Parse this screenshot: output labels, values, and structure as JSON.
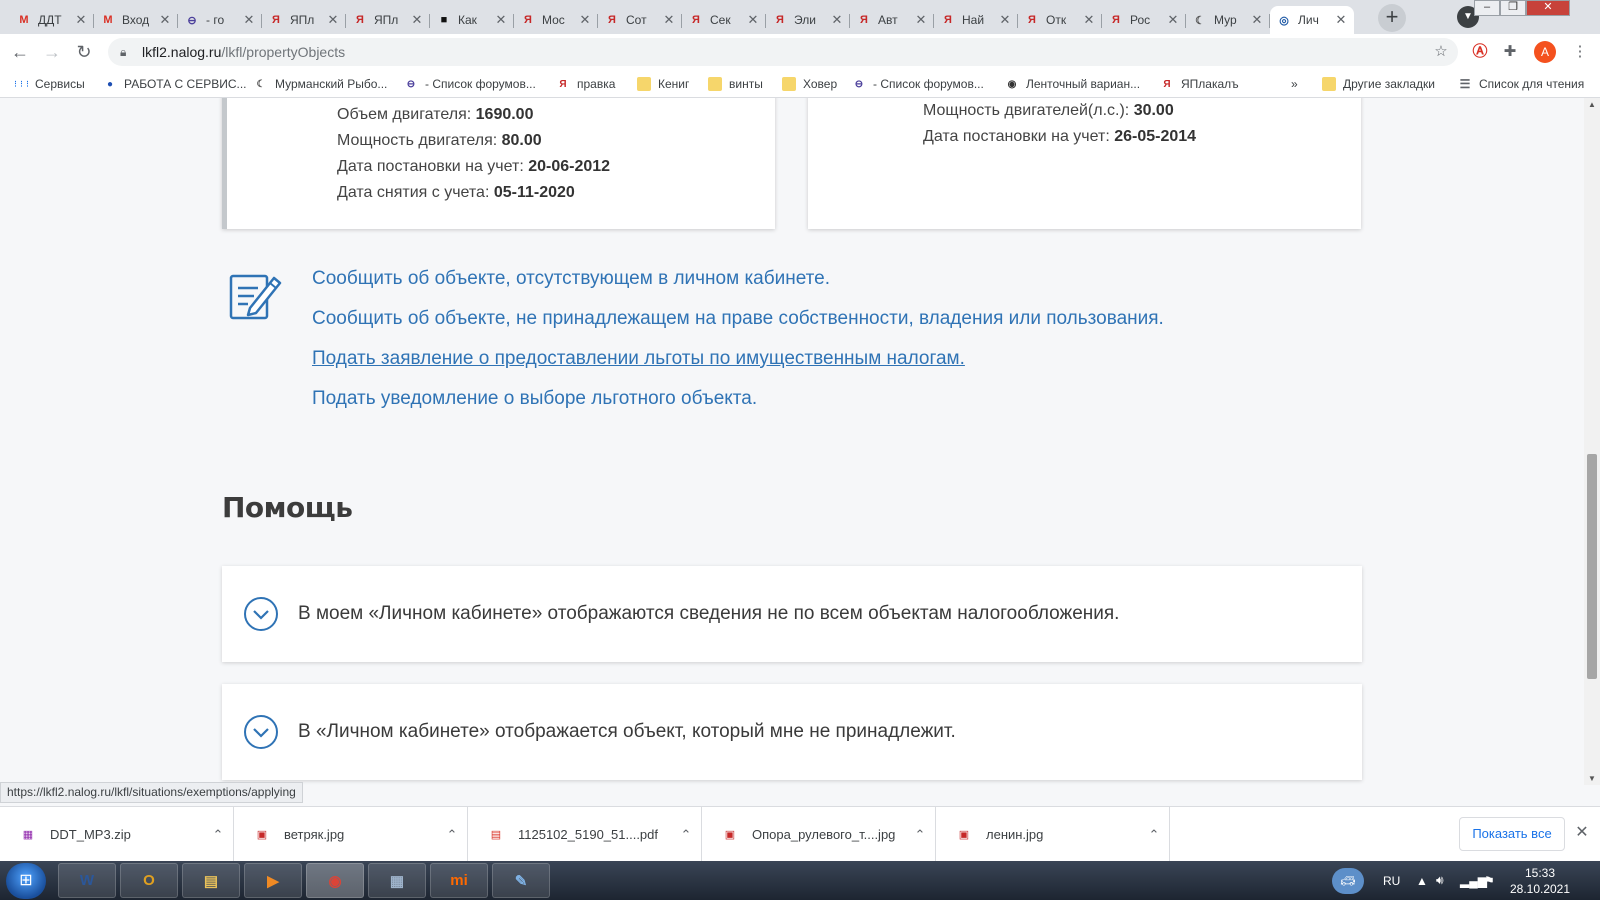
{
  "colors": {
    "link": "#2f73b5",
    "tab_strip": "#dee1e6",
    "avatar": "#f4511e"
  },
  "tabs": [
    {
      "title": "ДДТ",
      "icon": "gmail-icon",
      "glyph": "M",
      "color": "#d93025"
    },
    {
      "title": "Вход",
      "icon": "gmail-icon",
      "glyph": "M",
      "color": "#d93025"
    },
    {
      "title": "- го",
      "icon": "forum-icon",
      "glyph": "⊖",
      "color": "#4b3f9b"
    },
    {
      "title": "ЯПл",
      "icon": "yaplakal-icon",
      "glyph": "Я",
      "color": "#c62828"
    },
    {
      "title": "ЯПл",
      "icon": "yaplakal-icon",
      "glyph": "Я",
      "color": "#c62828"
    },
    {
      "title": "Как",
      "icon": "site-icon",
      "glyph": "■",
      "color": "#111111"
    },
    {
      "title": "Мос",
      "icon": "yaplakal-icon",
      "glyph": "Я",
      "color": "#c62828"
    },
    {
      "title": "Сот",
      "icon": "yaplakal-icon",
      "glyph": "Я",
      "color": "#c62828"
    },
    {
      "title": "Сек",
      "icon": "yaplakal-icon",
      "glyph": "Я",
      "color": "#c62828"
    },
    {
      "title": "Эли",
      "icon": "yaplakal-icon",
      "glyph": "Я",
      "color": "#c62828"
    },
    {
      "title": "Авт",
      "icon": "yaplakal-icon",
      "glyph": "Я",
      "color": "#c62828"
    },
    {
      "title": "Най",
      "icon": "yaplakal-icon",
      "glyph": "Я",
      "color": "#c62828"
    },
    {
      "title": "Отк",
      "icon": "yaplakal-icon",
      "glyph": "Я",
      "color": "#c62828"
    },
    {
      "title": "Рос",
      "icon": "yaplakal-icon",
      "glyph": "Я",
      "color": "#c62828"
    },
    {
      "title": "Мур",
      "icon": "fish-icon",
      "glyph": "☾",
      "color": "#555555"
    },
    {
      "title": "Лич",
      "icon": "nalog-icon",
      "glyph": "◎",
      "color": "#1f5aa6",
      "active": true
    }
  ],
  "address": {
    "host": "lkfl2.nalog.ru",
    "path": "/lkfl/propertyObjects"
  },
  "avatar_letter": "A",
  "bookmarks": [
    {
      "label": "Сервисы",
      "icon": "apps-grid-icon",
      "glyph": "⋮⋮⋮",
      "color": "#1a73e8"
    },
    {
      "label": "РАБОТА С СЕРВИС...",
      "icon": "tes-icon",
      "glyph": "●",
      "color": "#1e4fb3"
    },
    {
      "label": "Мурманский Рыбо...",
      "icon": "fish-icon",
      "glyph": "☾",
      "color": "#555555"
    },
    {
      "label": "- Список форумов...",
      "icon": "forum-icon",
      "glyph": "⊖",
      "color": "#4b3f9b"
    },
    {
      "label": "правка",
      "icon": "yaplakal-icon",
      "glyph": "Я",
      "color": "#c62828"
    },
    {
      "label": "Кениг",
      "icon": "folder-icon",
      "glyph": "",
      "color": "#f6d66b"
    },
    {
      "label": "винты",
      "icon": "folder-icon",
      "glyph": "",
      "color": "#f6d66b"
    },
    {
      "label": "Ховер",
      "icon": "folder-icon",
      "glyph": "",
      "color": "#f6d66b"
    },
    {
      "label": "- Список форумов...",
      "icon": "forum-icon",
      "glyph": "⊖",
      "color": "#4b3f9b"
    },
    {
      "label": "Ленточный вариан...",
      "icon": "globe-icon",
      "glyph": "◉",
      "color": "#333333"
    },
    {
      "label": "ЯПлакалъ",
      "icon": "yaplakal-icon",
      "glyph": "Я",
      "color": "#c62828"
    }
  ],
  "bookmarks_more": "»",
  "bookmarks_right": [
    {
      "label": "Другие закладки",
      "icon": "folder-icon"
    },
    {
      "label": "Список для чтения",
      "icon": "reading-list-icon"
    }
  ],
  "property_left": [
    {
      "label": "Объем двигателя: ",
      "value": "1690.00"
    },
    {
      "label": "Мощность двигателя: ",
      "value": "80.00"
    },
    {
      "label": "Дата постановки на учет: ",
      "value": "20-06-2012"
    },
    {
      "label": "Дата снятия с учета: ",
      "value": "05-11-2020"
    }
  ],
  "property_right": [
    {
      "label": "Мощность двигателей(л.с.): ",
      "value": "30.00"
    },
    {
      "label": "Дата постановки на учет: ",
      "value": "26-05-2014"
    }
  ],
  "report_links": [
    "Сообщить об объекте, отсутствующем в личном кабинете.",
    "Сообщить об объекте, не принадлежащем на праве собственности, владения или пользования.",
    "Подать заявление о предоставлении льготы по имущественным налогам.",
    "Подать уведомление о выборе льготного объекта."
  ],
  "help_title": "Помощь",
  "faq": [
    "В моем «Личном кабинете» отображаются сведения не по всем объектам налогообложения.",
    "В «Личном кабинете» отображается объект, который мне не принадлежит."
  ],
  "status_url": "https://lkfl2.nalog.ru/lkfl/situations/exemptions/applying",
  "downloads": [
    {
      "name": "DDT_MP3.zip",
      "icon": "zip-file-icon"
    },
    {
      "name": "ветряк.jpg",
      "icon": "image-file-icon"
    },
    {
      "name": "1125102_5190_51....pdf",
      "icon": "pdf-file-icon"
    },
    {
      "name": "Опора_рулевого_т....jpg",
      "icon": "image-file-icon"
    },
    {
      "name": "ленин.jpg",
      "icon": "image-file-icon"
    }
  ],
  "show_all": "Показать все",
  "taskbar_apps": [
    {
      "name": "word",
      "glyph": "W",
      "color": "#2b579a"
    },
    {
      "name": "outlook",
      "glyph": "O",
      "color": "#e0a020"
    },
    {
      "name": "explorer",
      "glyph": "▤",
      "color": "#e8c15a"
    },
    {
      "name": "media-player",
      "glyph": "▶",
      "color": "#f08a24"
    },
    {
      "name": "chrome",
      "glyph": "◉",
      "color": "#db4437",
      "active": true
    },
    {
      "name": "calculator",
      "glyph": "▦",
      "color": "#9fb4cc"
    },
    {
      "name": "mi",
      "glyph": "mi",
      "color": "#ff6900"
    },
    {
      "name": "paint",
      "glyph": "✎",
      "color": "#7fb2e5"
    }
  ],
  "tray": {
    "lang": "RU",
    "time": "15:33",
    "date": "28.10.2021"
  }
}
